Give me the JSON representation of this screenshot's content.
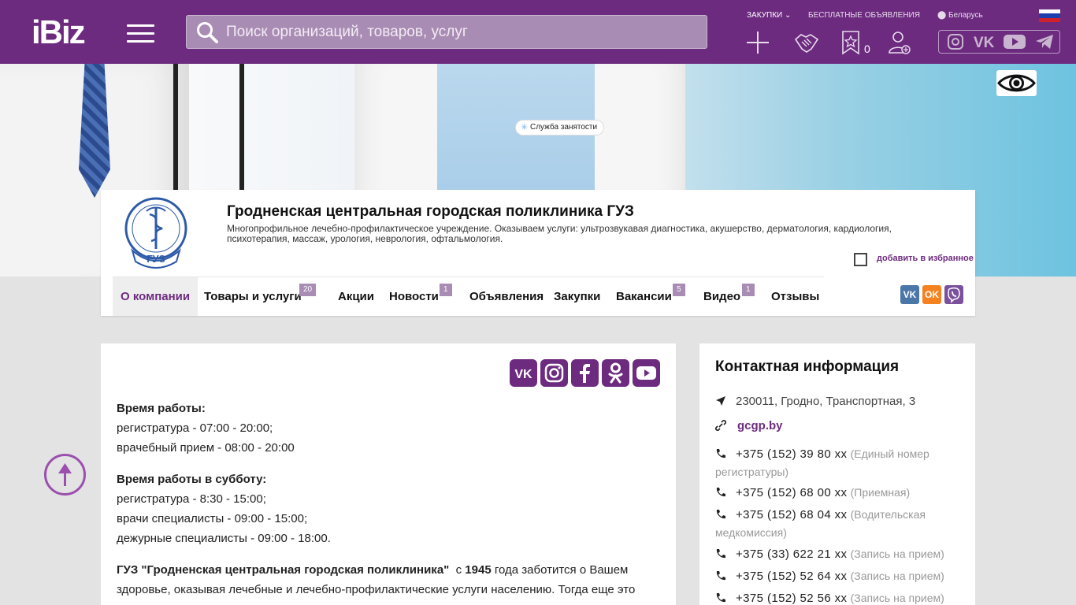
{
  "header": {
    "logo_text": "iBiz",
    "search_placeholder": "Поиск организаций, товаров, услуг",
    "link_purchases": "ЗАКУПКИ",
    "link_free_ads": "БЕСПЛАТНЫЕ ОБЪЯВЛЕНИЯ",
    "region": "Беларусь",
    "favorites_count": "0",
    "colors": {
      "brand": "#6d2b7f",
      "search_bg": "#a98cb4"
    }
  },
  "company": {
    "title": "Гродненская центральная городская поликлиника ГУЗ",
    "description": "Многопрофильное лечебно-профилактическое учреждение. Оказываем услуги: ультрозвукавая диагностика, акушерство, дерматология, кардиология, психотерапия, массаж, урология, неврология, офтальмология.",
    "add_favorite": "добавить в избранное",
    "tabs": [
      {
        "label": "О компании",
        "badge": ""
      },
      {
        "label": "Товары и услуги",
        "badge": "20"
      },
      {
        "label": "Акции",
        "badge": ""
      },
      {
        "label": "Новости",
        "badge": "1"
      },
      {
        "label": "Объявления",
        "badge": ""
      },
      {
        "label": "Закупки",
        "badge": ""
      },
      {
        "label": "Вакансии",
        "badge": "5"
      },
      {
        "label": "Видео",
        "badge": "1"
      },
      {
        "label": "Отзывы",
        "badge": ""
      }
    ],
    "employment_service": "Служба занятости"
  },
  "main": {
    "hours_title": "Время работы:",
    "hours_lines": [
      "регистратура - 07:00 - 20:00;",
      "врачебный прием - 08:00 - 20:00"
    ],
    "saturday_title": "Время работы в субботу:",
    "saturday_lines": [
      "регистратура - 8:30 - 15:00;",
      "врачи специалисты - 09:00 - 15:00;",
      "дежурные специалисты - 09:00 - 18:00."
    ],
    "about_bold": "ГУЗ \"Гродненская центральная городская поликлиника\"",
    "about_since": "с",
    "about_year": "1945",
    "about_rest": "года заботится о  Вашем здоровье, оказывая лечебные и лечебно-профилактические услуги населению. Тогда еще это"
  },
  "contacts": {
    "title": "Контактная информация",
    "address": "230011, Гродно, Транспортная, 3",
    "website": "gcgp.by",
    "phones": [
      {
        "number": "+375 (152) 39 80 xx",
        "note": "(Единый номер регистратуры)"
      },
      {
        "number": "+375 (152) 68 00 xx",
        "note": "(Приемная)"
      },
      {
        "number": "+375 (152) 68 04 xx",
        "note": "(Водительская медкомиссия)"
      },
      {
        "number": "+375 (33) 622 21 xx",
        "note": "(Запись на прием)"
      },
      {
        "number": "+375 (152) 52 64 xx",
        "note": "(Запись на прием)"
      },
      {
        "number": "+375 (152) 52 56 xx",
        "note": "(Запись на прием)"
      }
    ]
  }
}
